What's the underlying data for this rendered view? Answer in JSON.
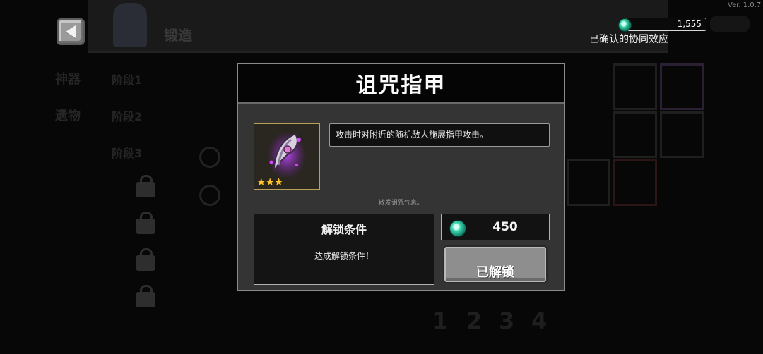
{
  "version": "Ver. 1.0.7",
  "currency": {
    "amount": "1,555",
    "icon": "green-gem-icon"
  },
  "synergy_label": "已确认的协同效应",
  "background": {
    "header_title": "锻造",
    "categories": [
      "神器",
      "遗物"
    ],
    "list_items": [
      "阶段1",
      "阶段2",
      "阶段3"
    ],
    "page_numbers": [
      "1",
      "2",
      "3",
      "4"
    ]
  },
  "modal": {
    "title": "诅咒指甲",
    "item_icon": "cursed-claw-icon",
    "stars": "★★★",
    "description": "攻击时对附近的随机敌人施展指甲攻击。",
    "flavor": "散发诅咒气息。",
    "unlock_title": "解锁条件",
    "unlock_condition": "达成解锁条件！",
    "price": "450",
    "price_icon": "green-gem-icon",
    "unlocked_button": "已解锁"
  }
}
